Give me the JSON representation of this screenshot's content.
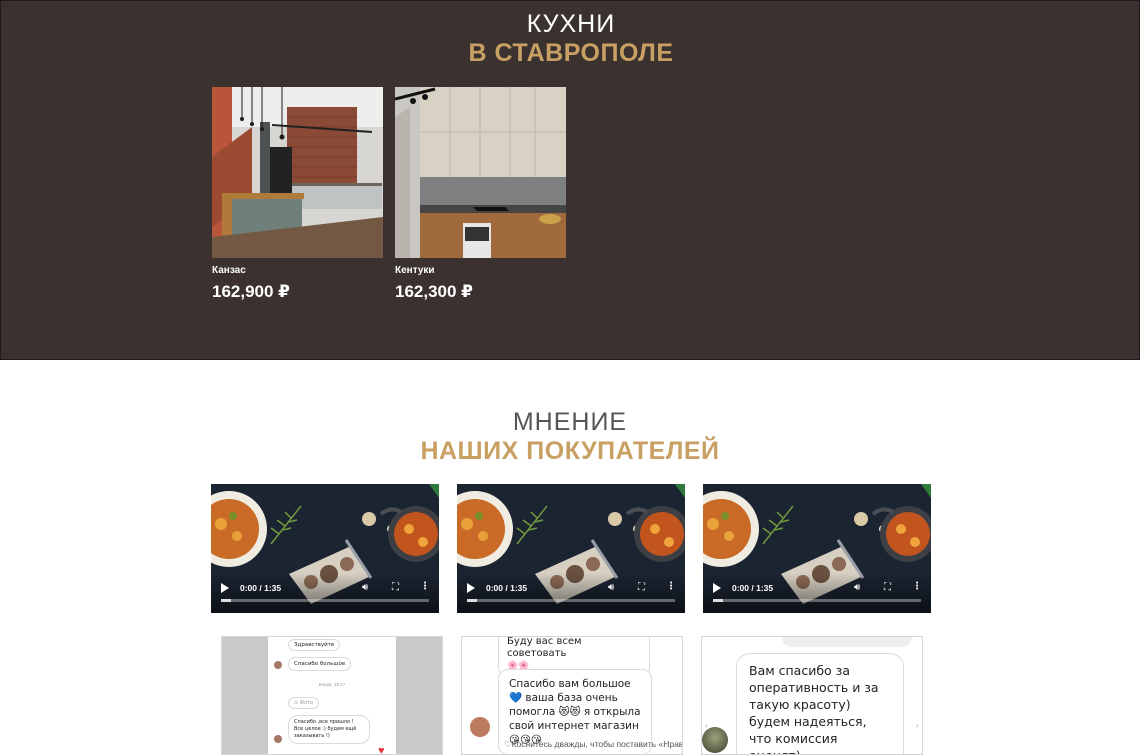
{
  "catalog": {
    "title_line1": "КУХНИ",
    "title_line2": "В СТАВРОПОЛЕ",
    "products": [
      {
        "name": "Канзас",
        "price": "162,900 ₽"
      },
      {
        "name": "Кентуки",
        "price": "162,300 ₽"
      }
    ]
  },
  "reviews": {
    "title_line1": "МНЕНИЕ",
    "title_line2": "НАШИХ ПОКУПАТЕЛЕЙ",
    "videos": [
      {
        "time": "0:00 / 1:35",
        "progress": 0.0
      },
      {
        "time": "0:00 / 1:35",
        "progress": 0.0
      },
      {
        "time": "0:00 / 1:35",
        "progress": 0.0
      }
    ],
    "screenshots": {
      "shot1": {
        "greeting": "Здравствуйте",
        "thanks": "Спасибо большое",
        "date": "Вчера, 19:17",
        "photo": "Фото",
        "message": "Спасибо ,все пришло ! Все целое :) будем ещё заказывать !)"
      },
      "shot2": {
        "top_line": "Буду вас всем советовать",
        "message": "Спасибо вам большое 💙 ваша база очень помогла 😻😻 я открыла свой интернет магазин 😘😘😘",
        "hint": "Коснитесь дважды, чтобы поставить «Нрав"
      },
      "shot3": {
        "message": "Вам спасибо за оперативность и за такую красоту) будем надеяться, что комиссия оценят)"
      }
    }
  },
  "colors": {
    "section_bg": "#3b3230",
    "accent_gold": "#c9a063",
    "white": "#ffffff"
  }
}
